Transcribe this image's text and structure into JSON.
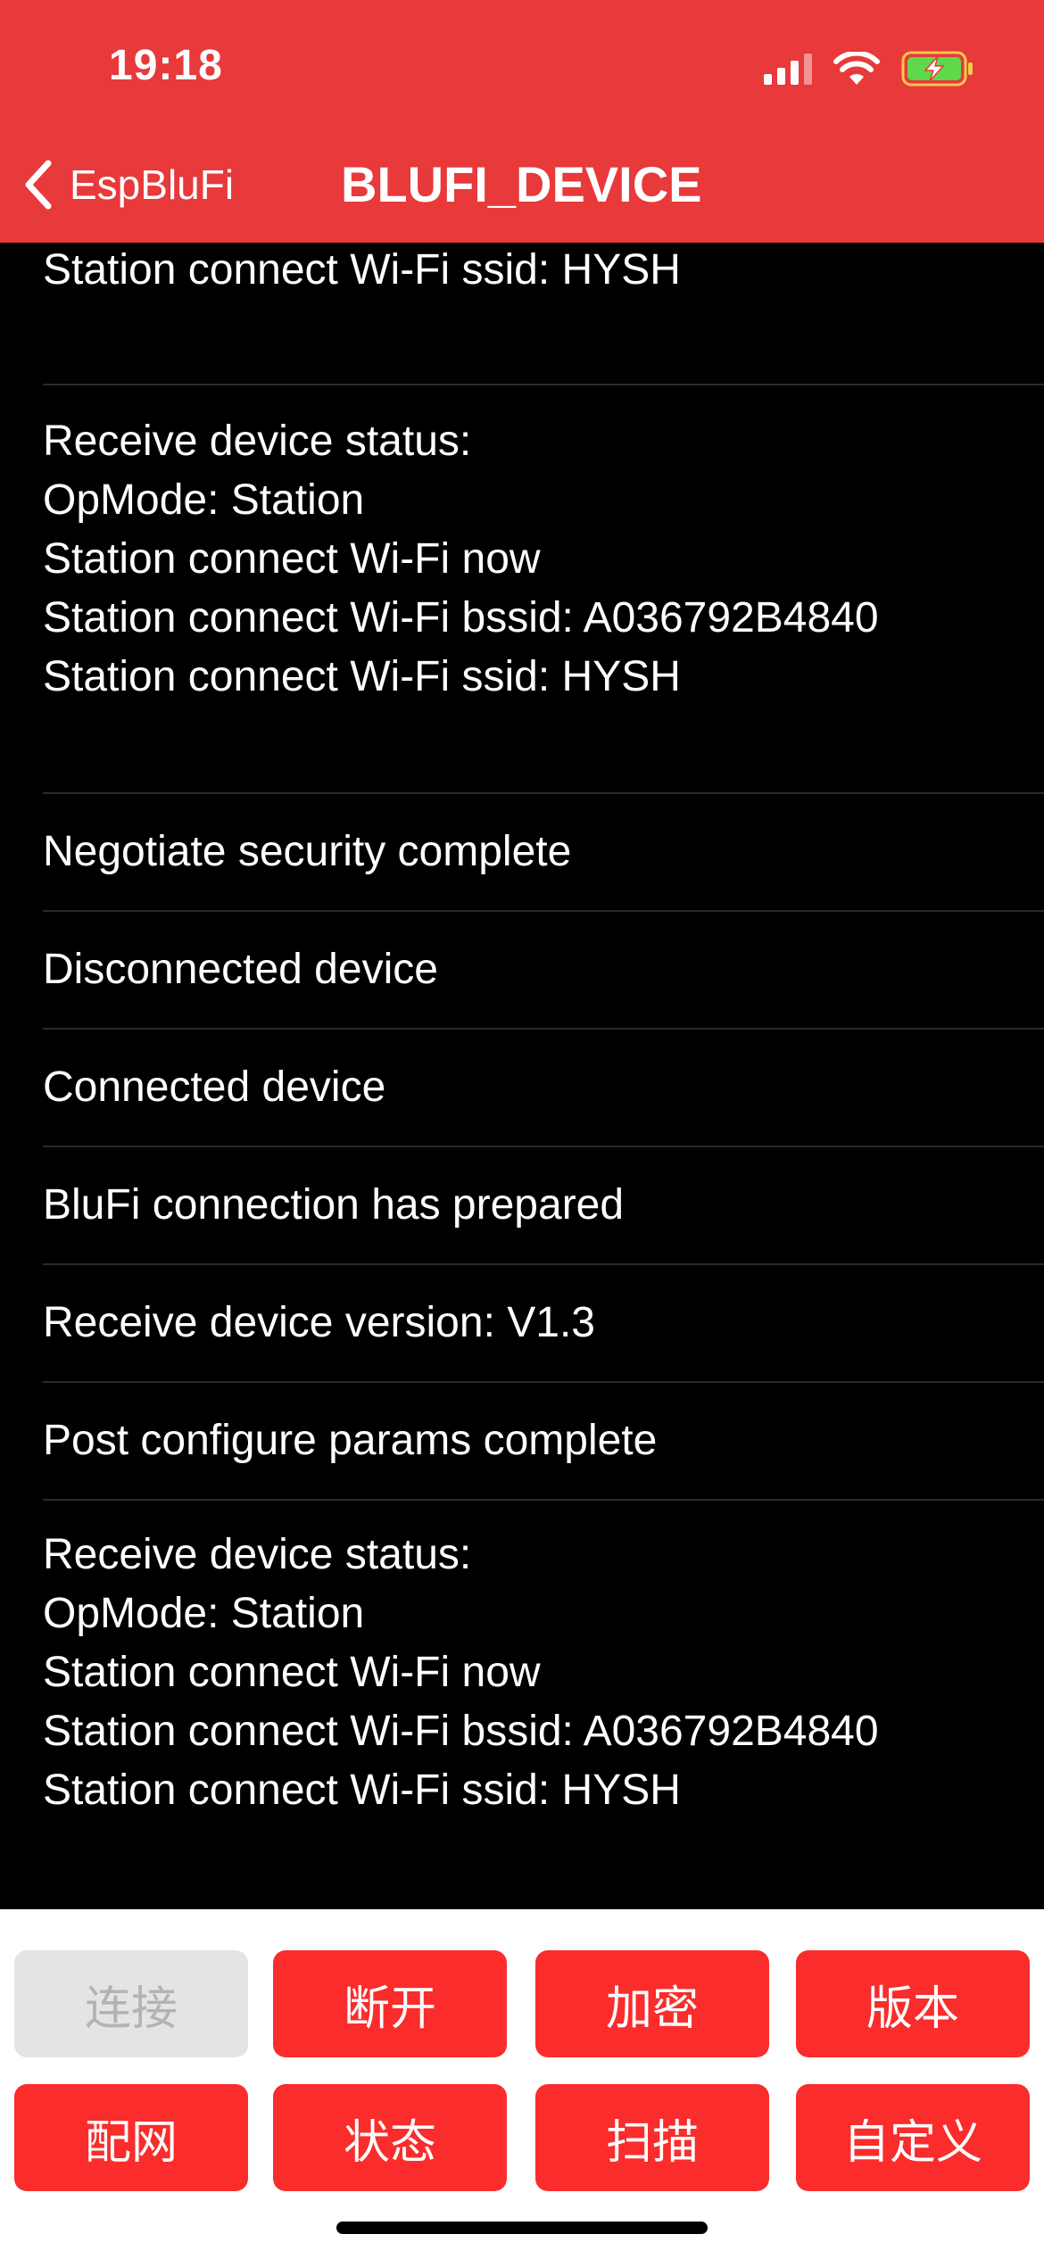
{
  "status_bar": {
    "time": "19:18",
    "icons": [
      "cellular-signal-icon",
      "wifi-icon",
      "battery-charging-icon"
    ],
    "battery_color": "#5fd84a"
  },
  "nav": {
    "back_label": "EspBluFi",
    "title": "BLUFI_DEVICE"
  },
  "log": {
    "items": [
      {
        "text": "Station connect Wi-Fi ssid: HYSH"
      },
      {
        "text": "Receive device status:\nOpMode: Station\nStation connect Wi-Fi now\nStation connect Wi-Fi bssid: A036792B4840\nStation connect Wi-Fi ssid: HYSH"
      },
      {
        "text": "Negotiate security complete"
      },
      {
        "text": "Disconnected device"
      },
      {
        "text": "Connected device"
      },
      {
        "text": "BluFi connection has prepared"
      },
      {
        "text": "Receive device version: V1.3"
      },
      {
        "text": "Post configure params complete"
      },
      {
        "text": "Receive device status:\nOpMode: Station\nStation connect Wi-Fi now\nStation connect Wi-Fi bssid: A036792B4840\nStation connect Wi-Fi ssid: HYSH"
      }
    ]
  },
  "actions": {
    "row1": [
      {
        "label": "连接",
        "state": "disabled"
      },
      {
        "label": "断开",
        "state": "enabled"
      },
      {
        "label": "加密",
        "state": "enabled"
      },
      {
        "label": "版本",
        "state": "enabled"
      }
    ],
    "row2": [
      {
        "label": "配网",
        "state": "enabled"
      },
      {
        "label": "状态",
        "state": "enabled"
      },
      {
        "label": "扫描",
        "state": "enabled"
      },
      {
        "label": "自定义",
        "state": "enabled"
      }
    ]
  },
  "colors": {
    "header": "#e8393b",
    "button": "#fa2c2c",
    "button_disabled": "#e4e4e4",
    "background": "#000000"
  }
}
